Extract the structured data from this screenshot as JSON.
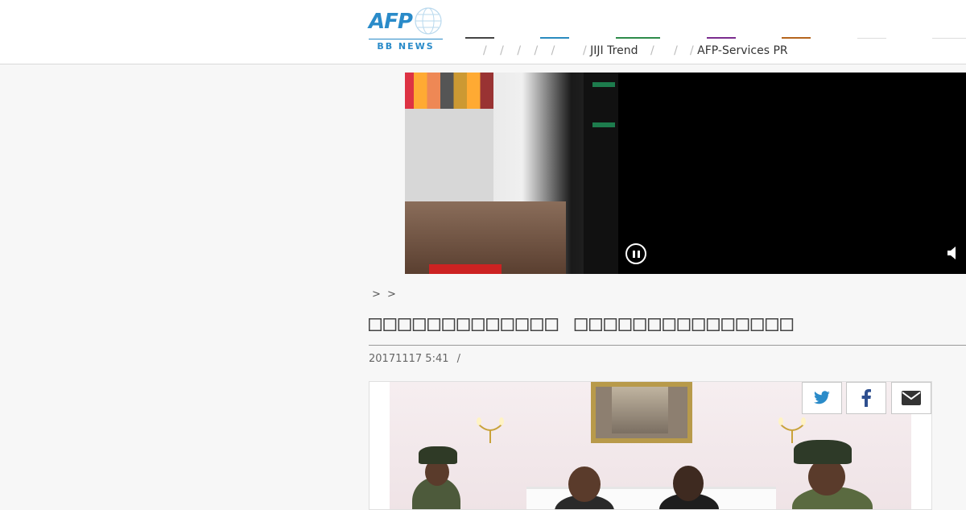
{
  "header": {
    "logo_text": "AFP",
    "logo_sub": "BB NEWS",
    "nav": {
      "separators": "/ / / / /",
      "item_jiji": "JIJI Trend",
      "separators2": "/ /",
      "item_afp_services": "AFP-Services PR",
      "bar_colors": [
        "#444444",
        "#2a8bbf",
        "#2e8b4a",
        "#7b2d8e",
        "#b5651d",
        "#dddddd",
        "#dddddd"
      ]
    }
  },
  "video": {
    "pause_label": "pause",
    "volume_label": "volume"
  },
  "breadcrumb": "> >",
  "article": {
    "title": "□□□□□□□□□□□□□ □□□□□□□□□□□□□□□",
    "date": "20171117 5:41",
    "date_sep": "/"
  },
  "share": {
    "twitter": "twitter",
    "facebook": "facebook",
    "email": "email"
  }
}
